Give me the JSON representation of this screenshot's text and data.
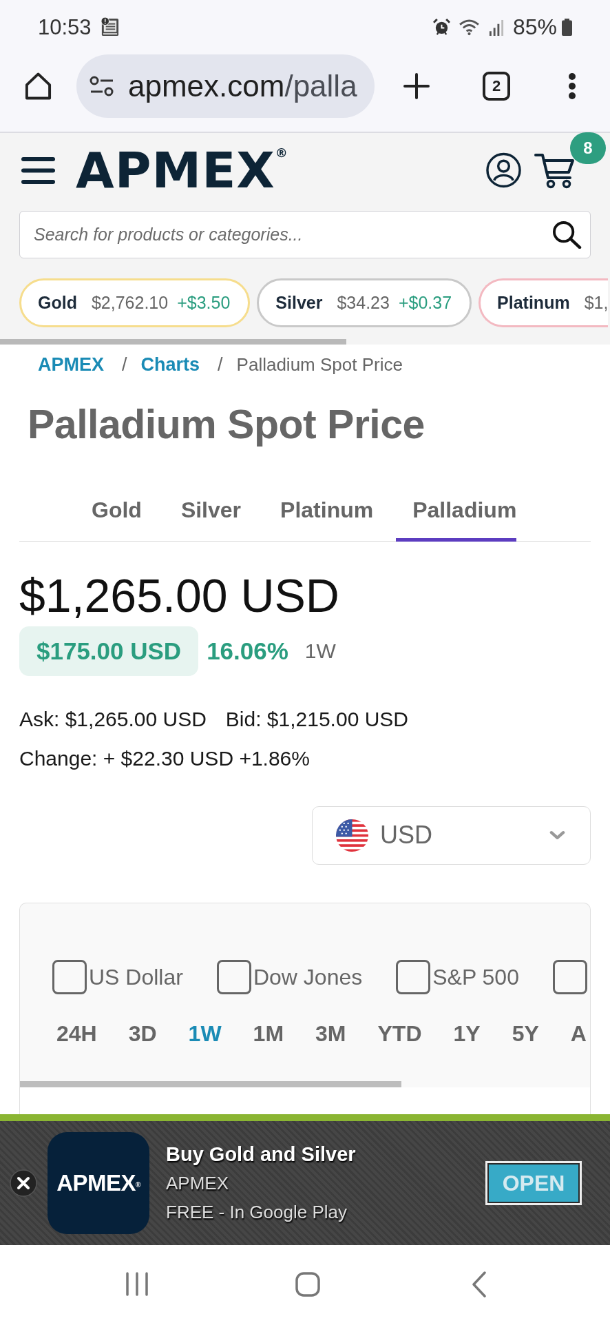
{
  "status_bar": {
    "time": "10:53",
    "battery": "85%"
  },
  "browser": {
    "url_host": "apmex.com",
    "url_path": "/palla",
    "tab_count": "2"
  },
  "header": {
    "logo": "APMEX$^{®}$",
    "cart_count": "8",
    "search": {
      "placeholder": "Search for products or categories..."
    }
  },
  "tickers": [
    {
      "name": "Gold",
      "price": "$2,762.10",
      "change": "+$3.50",
      "color": "#f6dd8d"
    },
    {
      "name": "Silver",
      "price": "$34.23",
      "change": "+$0.37",
      "color": "#c9c9c9"
    },
    {
      "name": "Platinum",
      "price": "$1,",
      "color": "#f3b9c1"
    }
  ],
  "breadcrumb": [
    {
      "kind": "link",
      "label": "APMEX"
    },
    {
      "kind": "separator",
      "label": "/"
    },
    {
      "kind": "link",
      "label": "Charts"
    },
    {
      "kind": "separator",
      "label": "/"
    },
    {
      "kind": "current",
      "label": "Palladium Spot Price"
    }
  ],
  "title": "Palladium Spot Price",
  "metal_tabs": [
    {
      "label": "Gold",
      "selected": false
    },
    {
      "label": "Silver",
      "selected": false
    },
    {
      "label": "Platinum",
      "selected": false
    },
    {
      "label": "Palladium",
      "selected": true
    }
  ],
  "price": {
    "value": "$1,265.00 USD",
    "change": "$175.00 USD",
    "percent": "16.06%",
    "period": "1W"
  },
  "quote": {
    "ask": "Ask: $1,265.00 USD",
    "bid": "Bid: $1,215.00 USD",
    "change": "Change: + $22.30 USD +1.86%"
  },
  "currency_select": {
    "value": "USD"
  },
  "chart": {
    "comparisons": [
      {
        "label": "US Dollar",
        "checked": false
      },
      {
        "label": "Dow Jones",
        "checked": false
      },
      {
        "label": "S&P 500",
        "checked": false
      },
      {
        "checked": false
      }
    ],
    "ranges": [
      {
        "label": "24H",
        "selected": false
      },
      {
        "label": "3D",
        "selected": false
      },
      {
        "label": "1W",
        "selected": true
      },
      {
        "label": "1M",
        "selected": false
      },
      {
        "label": "3M",
        "selected": false
      },
      {
        "label": "YTD",
        "selected": false
      },
      {
        "label": "1Y",
        "selected": false
      },
      {
        "label": "5Y",
        "selected": false
      },
      {
        "label": "A",
        "selected": false
      }
    ]
  },
  "app_banner": {
    "icon_text": "APMEX$^{®}$",
    "title": "Buy Gold and Silver",
    "publisher": "APMEX",
    "price_note": "FREE - In Google Play",
    "button": "OPEN"
  }
}
